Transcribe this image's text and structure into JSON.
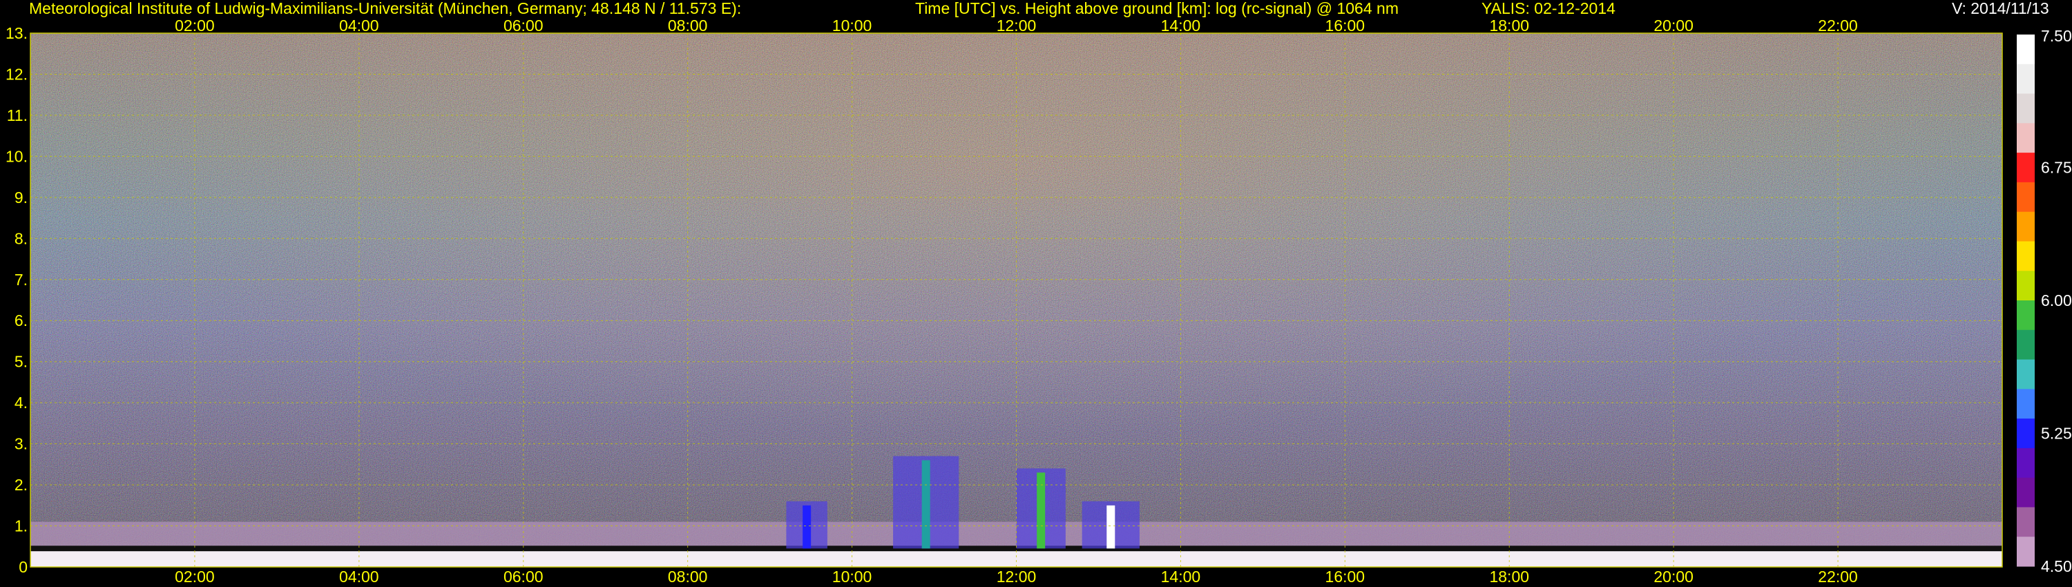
{
  "header": {
    "institute": "Meteorological Institute of Ludwig-Maximilians-Universität (München, Germany; 48.148 N / 11.573 E):",
    "title": "Time [UTC] vs. Height above ground [km]: log (rc-signal) @ 1064 nm",
    "station_date": "YALIS: 02-12-2014",
    "version": "V: 2014/11/13"
  },
  "colors": {
    "text": "#ffff00",
    "grid": "#c8c800",
    "background": "#000000"
  },
  "chart_data": {
    "type": "heatmap",
    "title": "Time [UTC] vs. Height above ground [km]: log (rc-signal) @ 1064 nm",
    "x_ticks": [
      "02:00",
      "04:00",
      "06:00",
      "08:00",
      "10:00",
      "12:00",
      "14:00",
      "16:00",
      "18:00",
      "20:00",
      "22:00"
    ],
    "x_tick_hours": [
      2,
      4,
      6,
      8,
      10,
      12,
      14,
      16,
      18,
      20,
      22
    ],
    "xlim_hours": [
      0,
      24
    ],
    "y_ticks": [
      "0",
      "1.",
      "2.",
      "3.",
      "4.",
      "5.",
      "6.",
      "7.",
      "8.",
      "9.",
      "10.",
      "11.",
      "12.",
      "13."
    ],
    "ylim_km": [
      0,
      13
    ],
    "grid": true,
    "colorbar": {
      "ticks": [
        "7.50",
        "6.75",
        "6.00",
        "5.25",
        "4.50"
      ],
      "tick_values": [
        7.5,
        6.75,
        6.0,
        5.25,
        4.5
      ],
      "range": [
        4.5,
        7.5
      ],
      "colors_top_to_bottom": [
        "#ffffff",
        "#eeeeee",
        "#e0d8d8",
        "#f0c0c0",
        "#ff2020",
        "#ff6010",
        "#ffa000",
        "#ffe000",
        "#c0e000",
        "#40c040",
        "#20a060",
        "#40c0c0",
        "#4080ff",
        "#2020ff",
        "#6010c0",
        "#7010a0",
        "#a060a0",
        "#c8a0c8"
      ]
    },
    "signal_features": {
      "boundary_layer_top_km": 0.45,
      "aerosol_layer_top_km": 1.1,
      "cloud_events": [
        {
          "start_hour": 9.2,
          "end_hour": 9.7,
          "top_km": 1.6
        },
        {
          "start_hour": 10.5,
          "end_hour": 11.3,
          "top_km": 2.7
        },
        {
          "start_hour": 12.0,
          "end_hour": 12.6,
          "top_km": 2.4
        },
        {
          "start_hour": 12.8,
          "end_hour": 13.5,
          "top_km": 1.6
        }
      ]
    }
  }
}
